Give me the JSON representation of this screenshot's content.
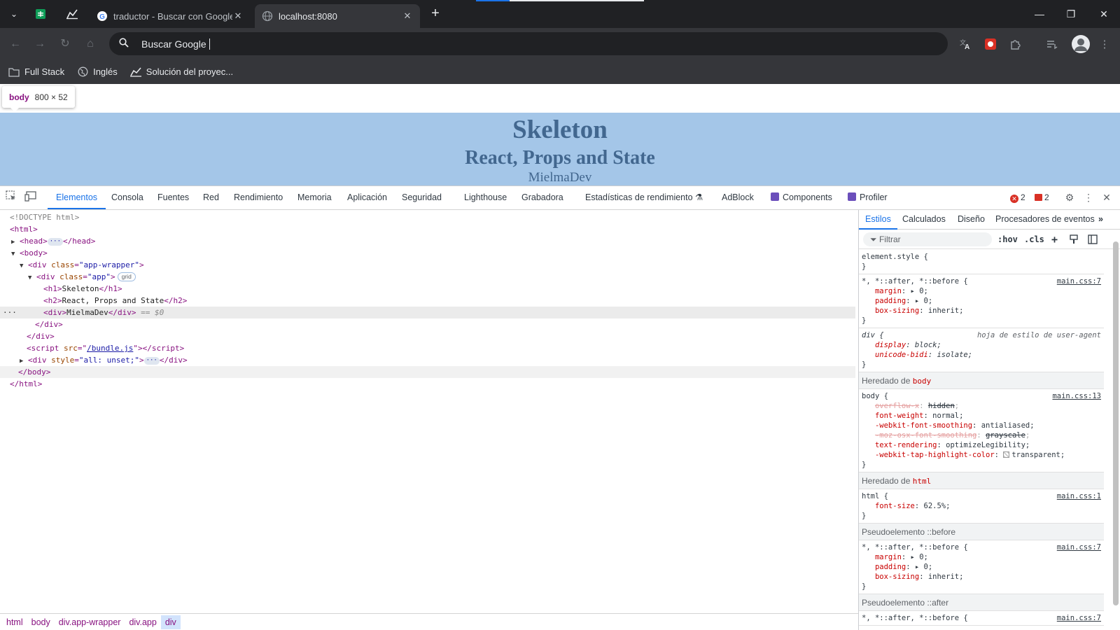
{
  "browser": {
    "tabs": [
      {
        "title": "traductor - Buscar con Google",
        "active": false
      },
      {
        "title": "localhost:8080",
        "active": true
      }
    ],
    "address_bar": {
      "value": "Buscar Google"
    },
    "bookmarks": [
      "Full Stack",
      "Inglés",
      "Solución del proyec..."
    ]
  },
  "page": {
    "inspect_tooltip": {
      "tag": "body",
      "dims": "800 × 52"
    },
    "h1": "Skeleton",
    "h2": "React, Props and State",
    "div": "MielmaDev"
  },
  "devtools": {
    "tabs": [
      "Elementos",
      "Consola",
      "Fuentes",
      "Red",
      "Rendimiento",
      "Memoria",
      "Aplicación",
      "Seguridad",
      "Lighthouse",
      "Grabadora",
      "Estadísticas de rendimiento",
      "AdBlock",
      "Components",
      "Profiler"
    ],
    "errors_count": "2",
    "issues_count": "2",
    "dom": {
      "doctype": "<!DOCTYPE html>",
      "wrapper_class": "\"app-wrapper\"",
      "app_class": "\"app\"",
      "grid_badge": "grid",
      "h1_text": "Skeleton",
      "h2_text": "React, Props and State",
      "div_text": "MielmaDev",
      "eq0": "== $0",
      "script_src": "/bundle.js",
      "unset_style": "\"all: unset;\""
    },
    "breadcrumbs": [
      "html",
      "body",
      "div.app-wrapper",
      "div.app",
      "div"
    ],
    "styles": {
      "tabs": [
        "Estilos",
        "Calculados",
        "Diseño",
        "Procesadores de eventos"
      ],
      "filter_placeholder": "Filtrar",
      "hov": ":hov",
      "cls": ".cls",
      "inherited_label": "Heredado de",
      "pseudo_before": "Pseudoelemento ::before",
      "pseudo_after": "Pseudoelemento ::after",
      "ua_label": "hoja de estilo de user-agent",
      "src_main7": "main.css:7",
      "src_main13": "main.css:13",
      "src_main1": "main.css:1"
    }
  }
}
